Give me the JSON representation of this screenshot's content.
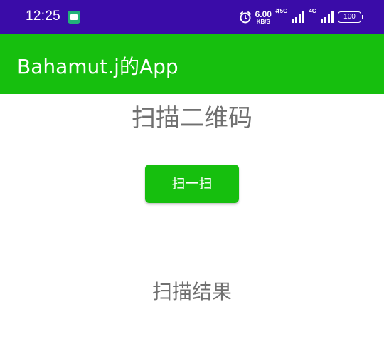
{
  "status_bar": {
    "time": "12:25",
    "notification_icon": "messages-icon",
    "alarm_icon": "alarm-icon",
    "net_speed_value": "6.00",
    "net_speed_unit": "KB/S",
    "sim1_label": "5G",
    "sim2_label": "4G",
    "battery_level": "100",
    "background_color": "#3a0ca8"
  },
  "app_bar": {
    "title": "Bahamut.j的App",
    "background_color": "#16bf0e"
  },
  "main": {
    "heading": "扫描二维码",
    "scan_button_label": "扫一扫",
    "result_text": "扫描结果"
  }
}
